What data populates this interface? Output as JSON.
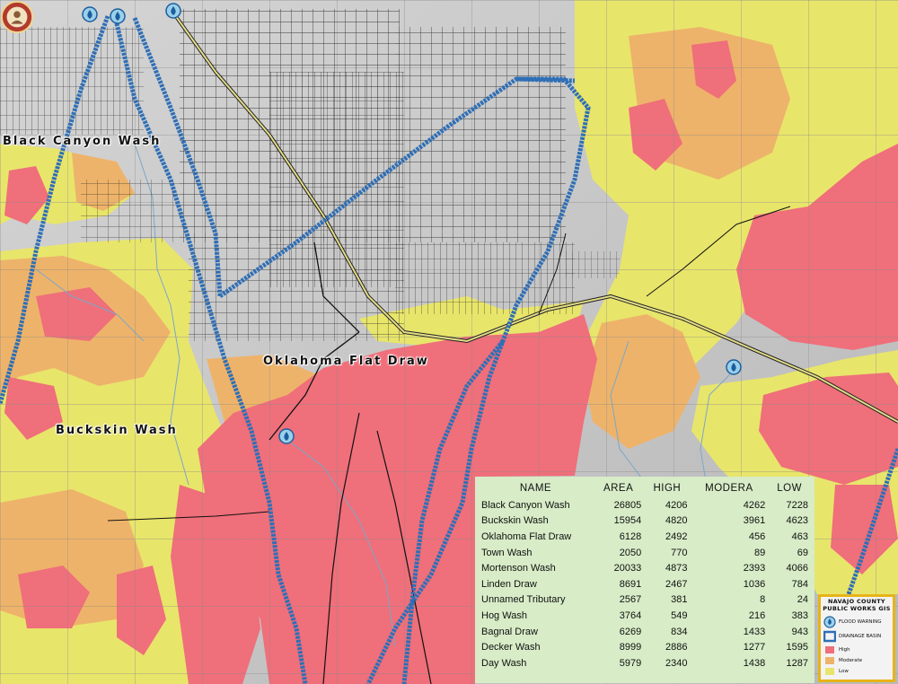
{
  "map": {
    "labels": {
      "black_canyon": "Black Canyon Wash",
      "oklahoma_flat": "Oklahoma Flat Draw",
      "buckskin": "Buckskin Wash"
    }
  },
  "table": {
    "headers": [
      "NAME",
      "AREA",
      "HIGH",
      "MODERA",
      "LOW"
    ],
    "rows": [
      {
        "name": "Black Canyon Wash",
        "area": "26805",
        "high": "4206",
        "moderate": "4262",
        "low": "7228"
      },
      {
        "name": "Buckskin Wash",
        "area": "15954",
        "high": "4820",
        "moderate": "3961",
        "low": "4623"
      },
      {
        "name": "Oklahoma Flat Draw",
        "area": "6128",
        "high": "2492",
        "moderate": "456",
        "low": "463"
      },
      {
        "name": "Town Wash",
        "area": "2050",
        "high": "770",
        "moderate": "89",
        "low": "69"
      },
      {
        "name": "Mortenson Wash",
        "area": "20033",
        "high": "4873",
        "moderate": "2393",
        "low": "4066"
      },
      {
        "name": "Linden Draw",
        "area": "8691",
        "high": "2467",
        "moderate": "1036",
        "low": "784"
      },
      {
        "name": "Unnamed Tributary",
        "area": "2567",
        "high": "381",
        "moderate": "8",
        "low": "24"
      },
      {
        "name": "Hog Wash",
        "area": "3764",
        "high": "549",
        "moderate": "216",
        "low": "383"
      },
      {
        "name": "Bagnal Draw",
        "area": "6269",
        "high": "834",
        "moderate": "1433",
        "low": "943"
      },
      {
        "name": "Decker Wash",
        "area": "8999",
        "high": "2886",
        "moderate": "1277",
        "low": "1595"
      },
      {
        "name": "Day Wash",
        "area": "5979",
        "high": "2340",
        "moderate": "1438",
        "low": "1287"
      }
    ]
  },
  "legend": {
    "title_line1": "NAVAJO COUNTY",
    "title_line2": "PUBLIC WORKS GIS",
    "flood_warning": "FLOOD WARNING",
    "drainage_basin": "DRAINAGE BASIN",
    "high": "High",
    "moderate": "Moderate",
    "low": "Low"
  },
  "colors": {
    "high": "#ef6f7a",
    "moderate": "#eeb36a",
    "low": "#e8e56b",
    "basin_line": "#2f6fb6",
    "panel": "#d7ecc7",
    "legend_border": "#e7b417"
  },
  "icons": {
    "flood_warning": "water-drop-icon",
    "seal": "county-seal-icon"
  }
}
